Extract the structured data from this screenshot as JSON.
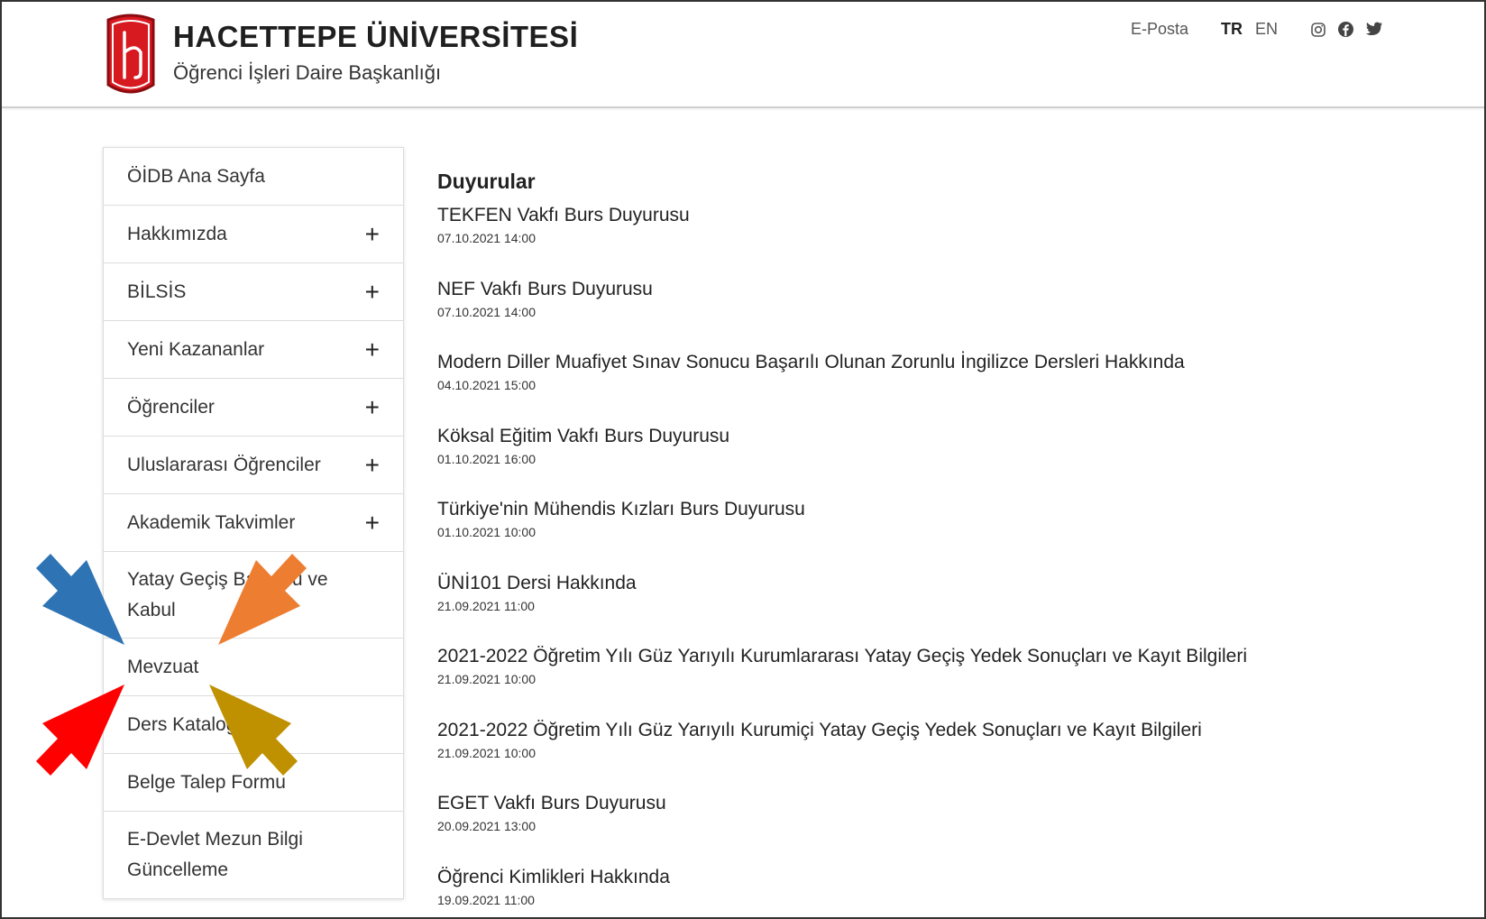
{
  "header": {
    "title": "HACETTEPE ÜNİVERSİTESİ",
    "subtitle": "Öğrenci İşleri Daire Başkanlığı",
    "email_link": "E-Posta",
    "lang_tr": "TR",
    "lang_en": "EN",
    "social_icons": [
      "instagram-icon",
      "facebook-icon",
      "twitter-icon"
    ]
  },
  "sidebar": {
    "items": [
      {
        "label": "ÖİDB Ana Sayfa",
        "expandable": false
      },
      {
        "label": "Hakkımızda",
        "expandable": true
      },
      {
        "label": "BİLSİS",
        "expandable": true
      },
      {
        "label": "Yeni Kazananlar",
        "expandable": true
      },
      {
        "label": "Öğrenciler",
        "expandable": true
      },
      {
        "label": "Uluslararası Öğrenciler",
        "expandable": true
      },
      {
        "label": "Akademik Takvimler",
        "expandable": true
      },
      {
        "label": "Yatay Geçiş Başvuru ve Kabul",
        "expandable": false
      },
      {
        "label": "Mevzuat",
        "expandable": false
      },
      {
        "label": "Ders Kataloğu",
        "expandable": false
      },
      {
        "label": "Belge Talep Formu",
        "expandable": false
      },
      {
        "label": "E-Devlet Mezun Bilgi Güncelleme",
        "expandable": false
      }
    ],
    "plus_glyph": "+"
  },
  "main": {
    "title": "Duyurular",
    "news": [
      {
        "title": "TEKFEN Vakfı Burs Duyurusu",
        "date": "07.10.2021 14:00"
      },
      {
        "title": "NEF Vakfı Burs Duyurusu",
        "date": "07.10.2021 14:00"
      },
      {
        "title": "Modern Diller Muafiyet Sınav Sonucu Başarılı Olunan Zorunlu İngilizce Dersleri Hakkında",
        "date": "04.10.2021 15:00"
      },
      {
        "title": "Köksal Eğitim Vakfı Burs Duyurusu",
        "date": "01.10.2021 16:00"
      },
      {
        "title": "Türkiye'nin Mühendis Kızları Burs Duyurusu",
        "date": "01.10.2021 10:00"
      },
      {
        "title": "ÜNİ101 Dersi Hakkında",
        "date": "21.09.2021 11:00"
      },
      {
        "title": "2021-2022 Öğretim Yılı Güz Yarıyılı Kurumlararası Yatay Geçiş Yedek Sonuçları ve Kayıt Bilgileri",
        "date": "21.09.2021 10:00"
      },
      {
        "title": "2021-2022 Öğretim Yılı Güz Yarıyılı Kurumiçi Yatay Geçiş Yedek Sonuçları ve Kayıt Bilgileri",
        "date": "21.09.2021 10:00"
      },
      {
        "title": "EGET Vakfı Burs Duyurusu",
        "date": "20.09.2021 13:00"
      },
      {
        "title": "Öğrenci Kimlikleri Hakkında",
        "date": "19.09.2021 11:00"
      }
    ]
  },
  "overlay": {
    "arrow_colors": [
      "#2e74b5",
      "#ed7d31",
      "#ff0000",
      "#bf9000"
    ],
    "target": "Mevzuat"
  }
}
